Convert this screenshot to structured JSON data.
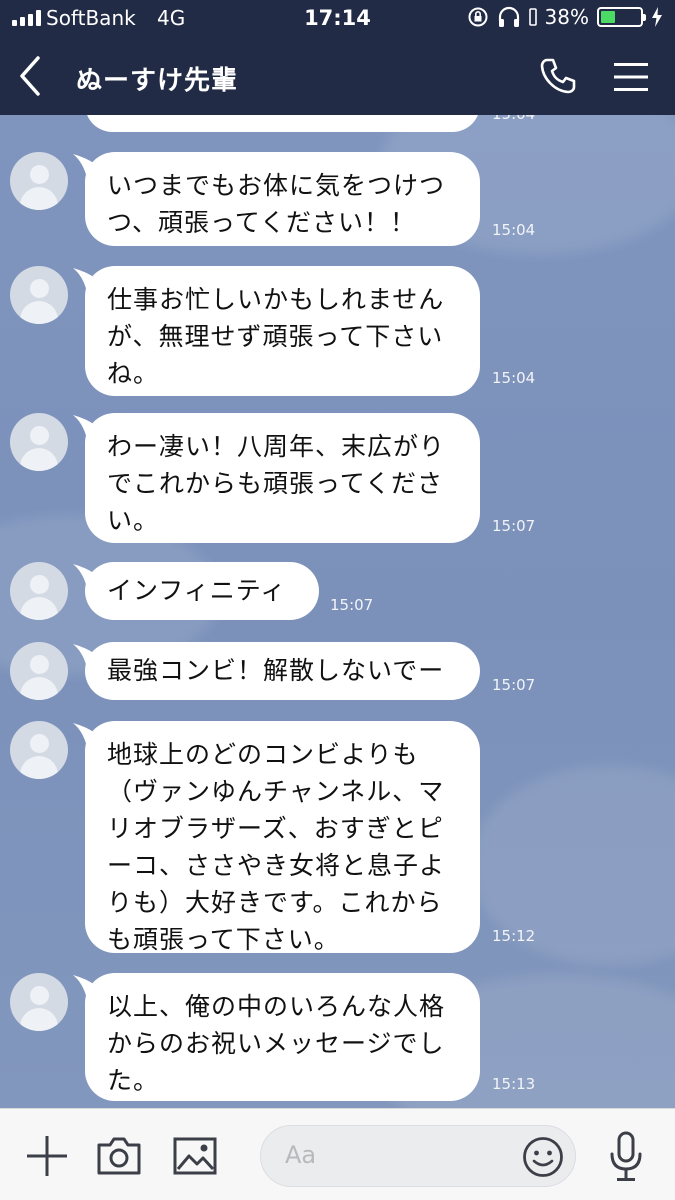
{
  "status_bar": {
    "carrier": "SoftBank",
    "network": "4G",
    "time": "17:14",
    "battery_percent": "38%",
    "battery_level": 0.38
  },
  "header": {
    "title": "ぬーすけ先輩",
    "back_icon": "chevron-left-icon",
    "call_icon": "phone-icon",
    "menu_icon": "hamburger-menu-icon"
  },
  "messages": [
    {
      "lines": [],
      "time": "15:04"
    },
    {
      "lines": [
        "いつまでもお体に気をつけつ",
        "つ、頑張ってください！！"
      ],
      "time": "15:04"
    },
    {
      "lines": [
        "仕事お忙しいかもしれません",
        "が、無理せず頑張って下さい",
        "ね。"
      ],
      "time": "15:04"
    },
    {
      "lines": [
        "わー凄い！八周年、末広がり",
        "でこれからも頑張ってくださ",
        "い。"
      ],
      "time": "15:07"
    },
    {
      "lines": [
        "インフィニティ"
      ],
      "time": "15:07"
    },
    {
      "lines": [
        "最強コンビ！解散しないでー"
      ],
      "time": "15:07"
    },
    {
      "lines": [
        "地球上のどのコンビよりも",
        "（ヴァンゆんチャンネル、マ",
        "リオブラザーズ、おすぎとピ",
        "ーコ、ささやき女将と息子よ",
        "りも）大好きです。これから",
        "も頑張って下さい。"
      ],
      "time": "15:12"
    },
    {
      "lines": [
        "以上、俺の中のいろんな人格",
        "からのお祝いメッセージでし",
        "た。"
      ],
      "time": "15:13"
    }
  ],
  "input_bar": {
    "placeholder": "Aa",
    "icons": [
      "plus-icon",
      "camera-icon",
      "image-icon",
      "emoji-icon",
      "microphone-icon"
    ]
  },
  "colors": {
    "header_bg": "#222b45",
    "chat_bg": "#7e93bb",
    "bubble_bg": "#ffffff",
    "battery_green": "#4cd964"
  }
}
